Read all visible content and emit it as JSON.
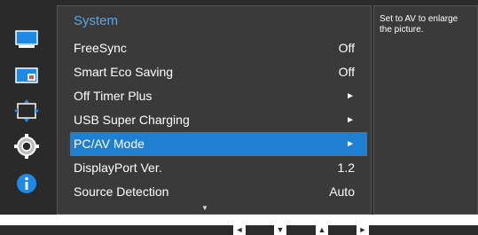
{
  "menu": {
    "title": "System",
    "items": [
      {
        "label": "FreeSync",
        "value": "Off"
      },
      {
        "label": "Smart Eco Saving",
        "value": "Off"
      },
      {
        "label": "Off Timer Plus",
        "value": "►"
      },
      {
        "label": "USB Super Charging",
        "value": "►"
      },
      {
        "label": "PC/AV Mode",
        "value": "►",
        "selected": true
      },
      {
        "label": "DisplayPort Ver.",
        "value": "1.2"
      },
      {
        "label": "Source Detection",
        "value": "Auto"
      }
    ],
    "scroll_indicator": "▼"
  },
  "help": {
    "text": "Set to AV to enlarge the picture."
  },
  "sidebar": {
    "icons": [
      "picture-icon",
      "picture-size-icon",
      "position-icon",
      "gear-icon",
      "info-icon"
    ]
  },
  "footer": {
    "keys": [
      "◄",
      "▼",
      "▲",
      "►"
    ]
  },
  "colors": {
    "accent": "#1f7fd0",
    "title": "#5aa8e6",
    "panel": "#3a3a3a"
  }
}
